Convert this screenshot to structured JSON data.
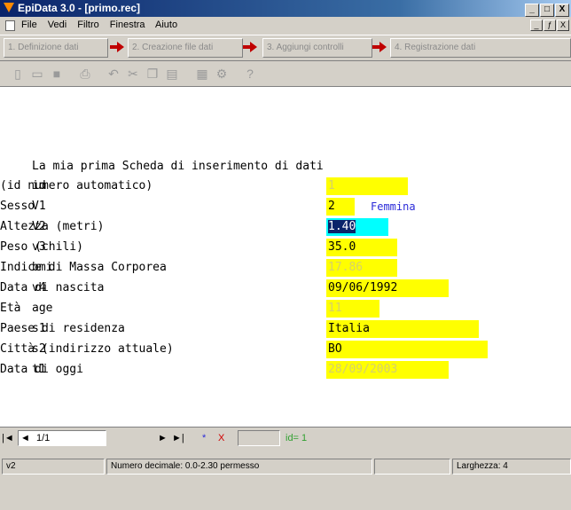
{
  "window": {
    "title": "EpiData 3.0 - [primo.rec]",
    "min": "_",
    "max": "□",
    "close": "X",
    "mdi_min": "_",
    "mdi_restore": "ƒ",
    "mdi_close": "X"
  },
  "menu": [
    "File",
    "Vedi",
    "Filtro",
    "Finestra",
    "Aiuto"
  ],
  "steps": [
    "1. Definizione dati",
    "2. Creazione file dati",
    "3. Aggiungi controlli",
    "4. Registrazione dati"
  ],
  "form": {
    "heading": "La mia prima Scheda di inserimento di dati",
    "rows": [
      {
        "name": "id",
        "label": "(id numero automatico)",
        "value": "1",
        "kind": "auto"
      },
      {
        "name": "V1",
        "label": "Sesso",
        "value": "2",
        "kind": "val",
        "value_label": "Femmina"
      },
      {
        "name": "V2",
        "label": "Altezza (metri)",
        "value": "1.40",
        "kind": "sel"
      },
      {
        "name": "v3",
        "label": "Peso (chili)",
        "value": "35.0",
        "kind": "val"
      },
      {
        "name": "bmi",
        "label": "Indice di Massa Corporea",
        "value": "17.86",
        "kind": "auto"
      },
      {
        "name": "v4",
        "label": "Data di nascita",
        "value": "09/06/1992",
        "kind": "val"
      },
      {
        "name": "age",
        "label": "Età",
        "value": "11",
        "kind": "auto"
      },
      {
        "name": "s1",
        "label": "Paese di residenza",
        "value": "Italia",
        "kind": "val"
      },
      {
        "name": "s2",
        "label": "Città (indirizzo attuale)",
        "value": "BO",
        "kind": "val"
      },
      {
        "name": "t1",
        "label": "Data di oggi",
        "value": "28/09/2003",
        "kind": "auto"
      }
    ]
  },
  "nav": {
    "record": "1/1",
    "id_label": "id= 1",
    "first": "|◄",
    "prev": "◄",
    "next": "►",
    "last": "►|",
    "new": "*",
    "delete": "X"
  },
  "status": {
    "field": "v2",
    "hint": "Numero decimale: 0.0-2.30 permesso",
    "width": "Larghezza: 4"
  },
  "colors": {
    "field_yellow": "#ffff00",
    "field_cyan": "#00ffff",
    "title_bar": "#0a246a",
    "value_label": "#2a2ad8",
    "arrow_red": "#c00000"
  }
}
